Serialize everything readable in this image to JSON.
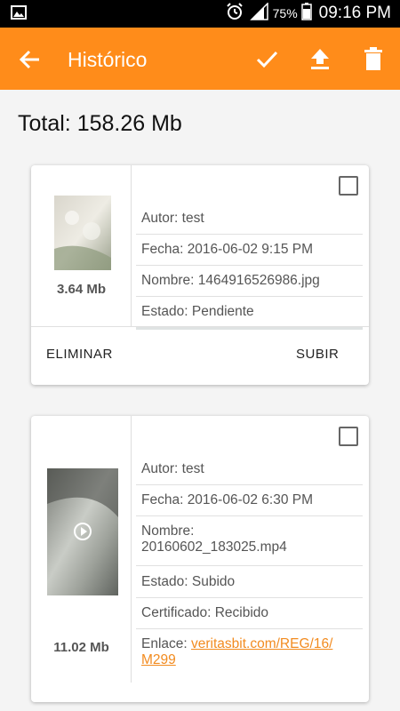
{
  "status_bar": {
    "battery": "75%",
    "time": "09:16 PM"
  },
  "app_bar": {
    "title": "Histórico",
    "back_icon": "arrow-back-icon",
    "actions": [
      "check-icon",
      "upload-icon",
      "delete-icon"
    ],
    "color": "#ff8c1a"
  },
  "total": "Total: 158.26 Mb",
  "items": [
    {
      "size": "3.64 Mb",
      "autor": "Autor: test",
      "fecha": "Fecha: 2016-06-02 9:15 PM",
      "nombre": "Nombre: 1464916526986.jpg",
      "estado": "Estado: Pendiente",
      "actions": {
        "delete": "ELIMINAR",
        "upload": "SUBIR"
      }
    },
    {
      "size": "11.02 Mb",
      "autor": "Autor: test",
      "fecha": "Fecha: 2016-06-02 6:30 PM",
      "nombre_label": "Nombre:",
      "nombre_value": "20160602_183025.mp4",
      "estado": "Estado: Subido",
      "certificado": "Certificado: Recibido",
      "enlace_label": "Enlace:",
      "enlace_value_1": "veritasbit.com/REG/16/",
      "enlace_value_2": "M299",
      "video_icon": "play-icon"
    }
  ]
}
